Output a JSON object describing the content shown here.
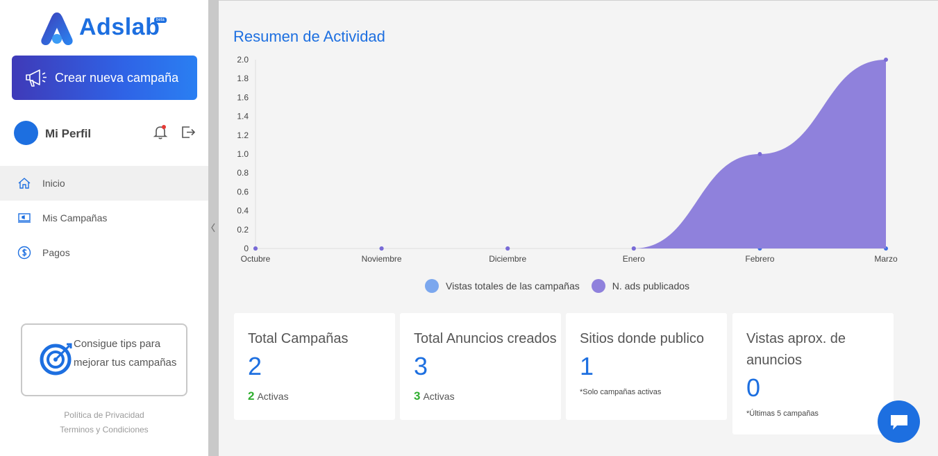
{
  "app": {
    "name": "Adslab",
    "badge": "beta"
  },
  "sidebar": {
    "create_button": {
      "label": "Crear nueva campaña",
      "icon": "megaphone-icon"
    },
    "profile": {
      "name": "Mi Perfil"
    },
    "nav": [
      {
        "label": "Inicio",
        "icon": "home-icon",
        "active": true
      },
      {
        "label": "Mis Campañas",
        "icon": "campaign-icon",
        "active": false
      },
      {
        "label": "Pagos",
        "icon": "dollar-icon",
        "active": false
      }
    ],
    "tips": {
      "label": "Consigue tips para mejorar tus campañas"
    },
    "footer": {
      "privacy": "Política de Privacidad",
      "terms": "Terminos y Condiciones"
    }
  },
  "main": {
    "title": "Resumen de Actividad"
  },
  "chart_data": {
    "type": "area",
    "categories": [
      "Octubre",
      "Noviembre",
      "Diciembre",
      "Enero",
      "Febrero",
      "Marzo"
    ],
    "series": [
      {
        "name": "Vistas totales de las campañas",
        "values": [
          0,
          0,
          0,
          0,
          0,
          0
        ],
        "color": "#7ba7ee"
      },
      {
        "name": "N. ads publicados",
        "values": [
          0,
          0,
          0,
          0,
          1,
          2
        ],
        "color": "#8f81dc"
      }
    ],
    "ylim": [
      0,
      2.0
    ],
    "yticks": [
      "0",
      "0.2",
      "0.4",
      "0.6",
      "0.8",
      "1.0",
      "1.2",
      "1.4",
      "1.6",
      "1.8",
      "2.0"
    ],
    "grid": false,
    "legend": "bottom"
  },
  "cards": [
    {
      "title": "Total Campañas",
      "value": "2",
      "sub_count": "2",
      "sub_label": "Activas"
    },
    {
      "title": "Total Anuncios creados",
      "value": "3",
      "sub_count": "3",
      "sub_label": "Activas"
    },
    {
      "title": "Sitios donde publico",
      "value": "1",
      "note": "*Solo campañas activas"
    },
    {
      "title": "Vistas aprox. de anuncios",
      "value": "0",
      "note": "*Últimas 5 campañas"
    }
  ],
  "colors": {
    "accent": "#1d6fe0",
    "active_green": "#2fae2f",
    "series_purple": "#8f81dc",
    "series_blue": "#7ba7ee"
  }
}
